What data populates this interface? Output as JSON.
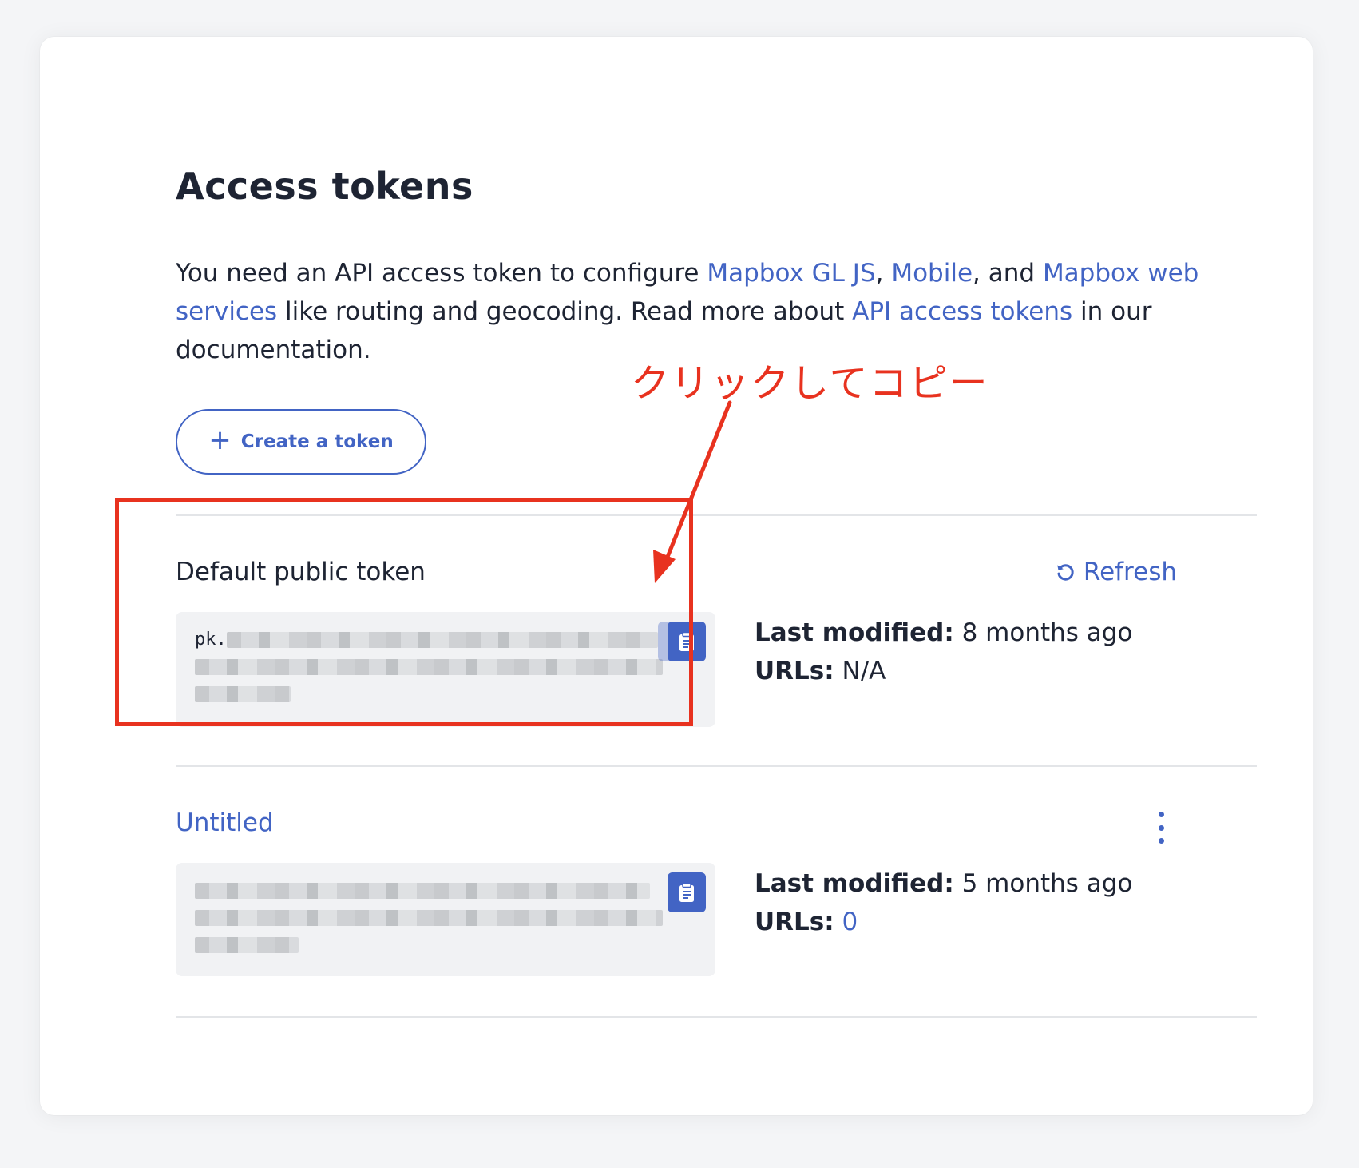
{
  "page": {
    "title": "Access tokens",
    "description": {
      "t1": "You need an API access token to configure ",
      "l1": "Mapbox GL JS",
      "t2": ", ",
      "l2": "Mobile",
      "t3": ", and ",
      "l3": "Mapbox web services",
      "t4": " like routing and geocoding. Read more about ",
      "l4": "API access tokens",
      "t5": " in our documentation."
    },
    "create_button_label": "Create a token"
  },
  "tokens": [
    {
      "name": "Default public token",
      "prefix": "pk.",
      "refresh_label": "Refresh",
      "last_modified_label": "Last modified:",
      "last_modified_value": "8 months ago",
      "urls_label": "URLs:",
      "urls_value": "N/A"
    },
    {
      "name": "Untitled",
      "last_modified_label": "Last modified:",
      "last_modified_value": "5 months ago",
      "urls_label": "URLs:",
      "urls_value": "0"
    }
  ],
  "annotation": {
    "text": "クリックしてコピー",
    "color": "#e8321f"
  },
  "colors": {
    "accent": "#4264c4",
    "text": "#1e2433",
    "token_bg": "#f1f2f4",
    "divider": "#e3e5e8"
  },
  "icons": {
    "create": "plus-icon",
    "copy": "clipboard-icon",
    "refresh": "refresh-icon",
    "menu": "kebab-menu-icon"
  }
}
